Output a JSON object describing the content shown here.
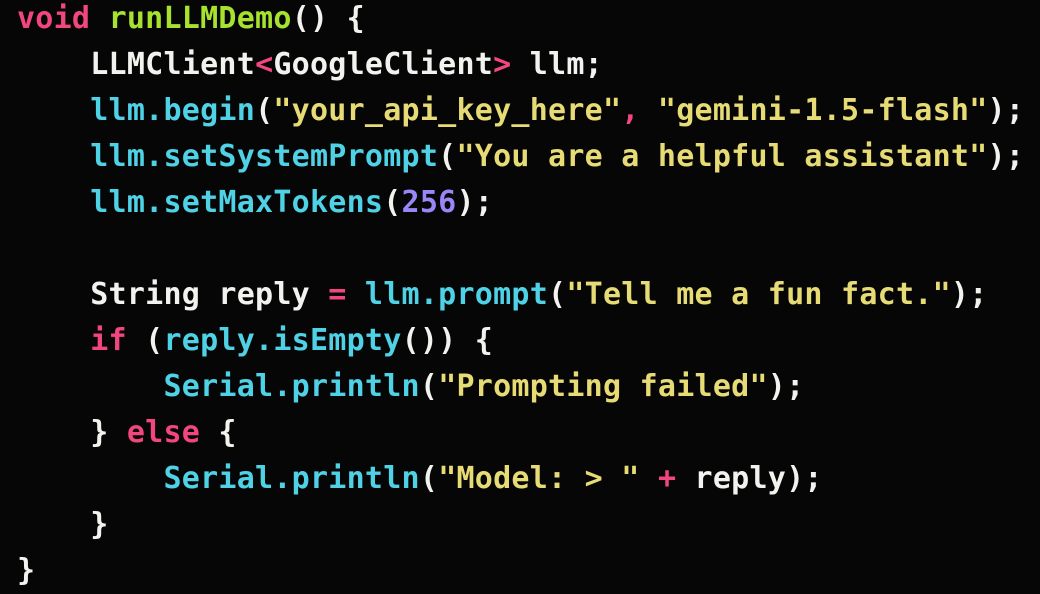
{
  "palette": {
    "background": "#060606",
    "plain": "#f2f2ef",
    "keyword": "#f2467e",
    "function": "#a6e22e",
    "method": "#4fd1e6",
    "string": "#e6db74",
    "number": "#9a86f7"
  },
  "code_lines": [
    [
      {
        "t": "void",
        "c": "keyword"
      },
      {
        "t": " ",
        "c": "plain"
      },
      {
        "t": "runLLMDemo",
        "c": "function"
      },
      {
        "t": "() {",
        "c": "plain"
      }
    ],
    [
      {
        "t": "    LLMClient",
        "c": "plain"
      },
      {
        "t": "<",
        "c": "keyword"
      },
      {
        "t": "GoogleClient",
        "c": "plain"
      },
      {
        "t": ">",
        "c": "keyword"
      },
      {
        "t": " llm;",
        "c": "plain"
      }
    ],
    [
      {
        "t": "    ",
        "c": "plain"
      },
      {
        "t": "llm.begin",
        "c": "method"
      },
      {
        "t": "(",
        "c": "plain"
      },
      {
        "t": "\"your_api_key_here\"",
        "c": "string"
      },
      {
        "t": ", ",
        "c": "keyword"
      },
      {
        "t": "\"gemini-1.5-flash\"",
        "c": "string"
      },
      {
        "t": ");",
        "c": "plain"
      }
    ],
    [
      {
        "t": "    ",
        "c": "plain"
      },
      {
        "t": "llm.setSystemPrompt",
        "c": "method"
      },
      {
        "t": "(",
        "c": "plain"
      },
      {
        "t": "\"You are a helpful assistant\"",
        "c": "string"
      },
      {
        "t": ");",
        "c": "plain"
      }
    ],
    [
      {
        "t": "    ",
        "c": "plain"
      },
      {
        "t": "llm.setMaxTokens",
        "c": "method"
      },
      {
        "t": "(",
        "c": "plain"
      },
      {
        "t": "256",
        "c": "number"
      },
      {
        "t": ");",
        "c": "plain"
      }
    ],
    [
      {
        "t": "",
        "c": "plain"
      }
    ],
    [
      {
        "t": "    String reply ",
        "c": "plain"
      },
      {
        "t": "=",
        "c": "keyword"
      },
      {
        "t": " ",
        "c": "plain"
      },
      {
        "t": "llm.prompt",
        "c": "method"
      },
      {
        "t": "(",
        "c": "plain"
      },
      {
        "t": "\"Tell me a fun fact.\"",
        "c": "string"
      },
      {
        "t": ");",
        "c": "plain"
      }
    ],
    [
      {
        "t": "    ",
        "c": "plain"
      },
      {
        "t": "if",
        "c": "keyword"
      },
      {
        "t": " (",
        "c": "plain"
      },
      {
        "t": "reply.isEmpty",
        "c": "method"
      },
      {
        "t": "()) {",
        "c": "plain"
      }
    ],
    [
      {
        "t": "        ",
        "c": "plain"
      },
      {
        "t": "Serial.println",
        "c": "method"
      },
      {
        "t": "(",
        "c": "plain"
      },
      {
        "t": "\"Prompting failed\"",
        "c": "string"
      },
      {
        "t": ");",
        "c": "plain"
      }
    ],
    [
      {
        "t": "    } ",
        "c": "plain"
      },
      {
        "t": "else",
        "c": "keyword"
      },
      {
        "t": " {",
        "c": "plain"
      }
    ],
    [
      {
        "t": "        ",
        "c": "plain"
      },
      {
        "t": "Serial.println",
        "c": "method"
      },
      {
        "t": "(",
        "c": "plain"
      },
      {
        "t": "\"Model: > \"",
        "c": "string"
      },
      {
        "t": " ",
        "c": "plain"
      },
      {
        "t": "+",
        "c": "keyword"
      },
      {
        "t": " reply);",
        "c": "plain"
      }
    ],
    [
      {
        "t": "    }",
        "c": "plain"
      }
    ],
    [
      {
        "t": "}",
        "c": "plain"
      }
    ]
  ]
}
